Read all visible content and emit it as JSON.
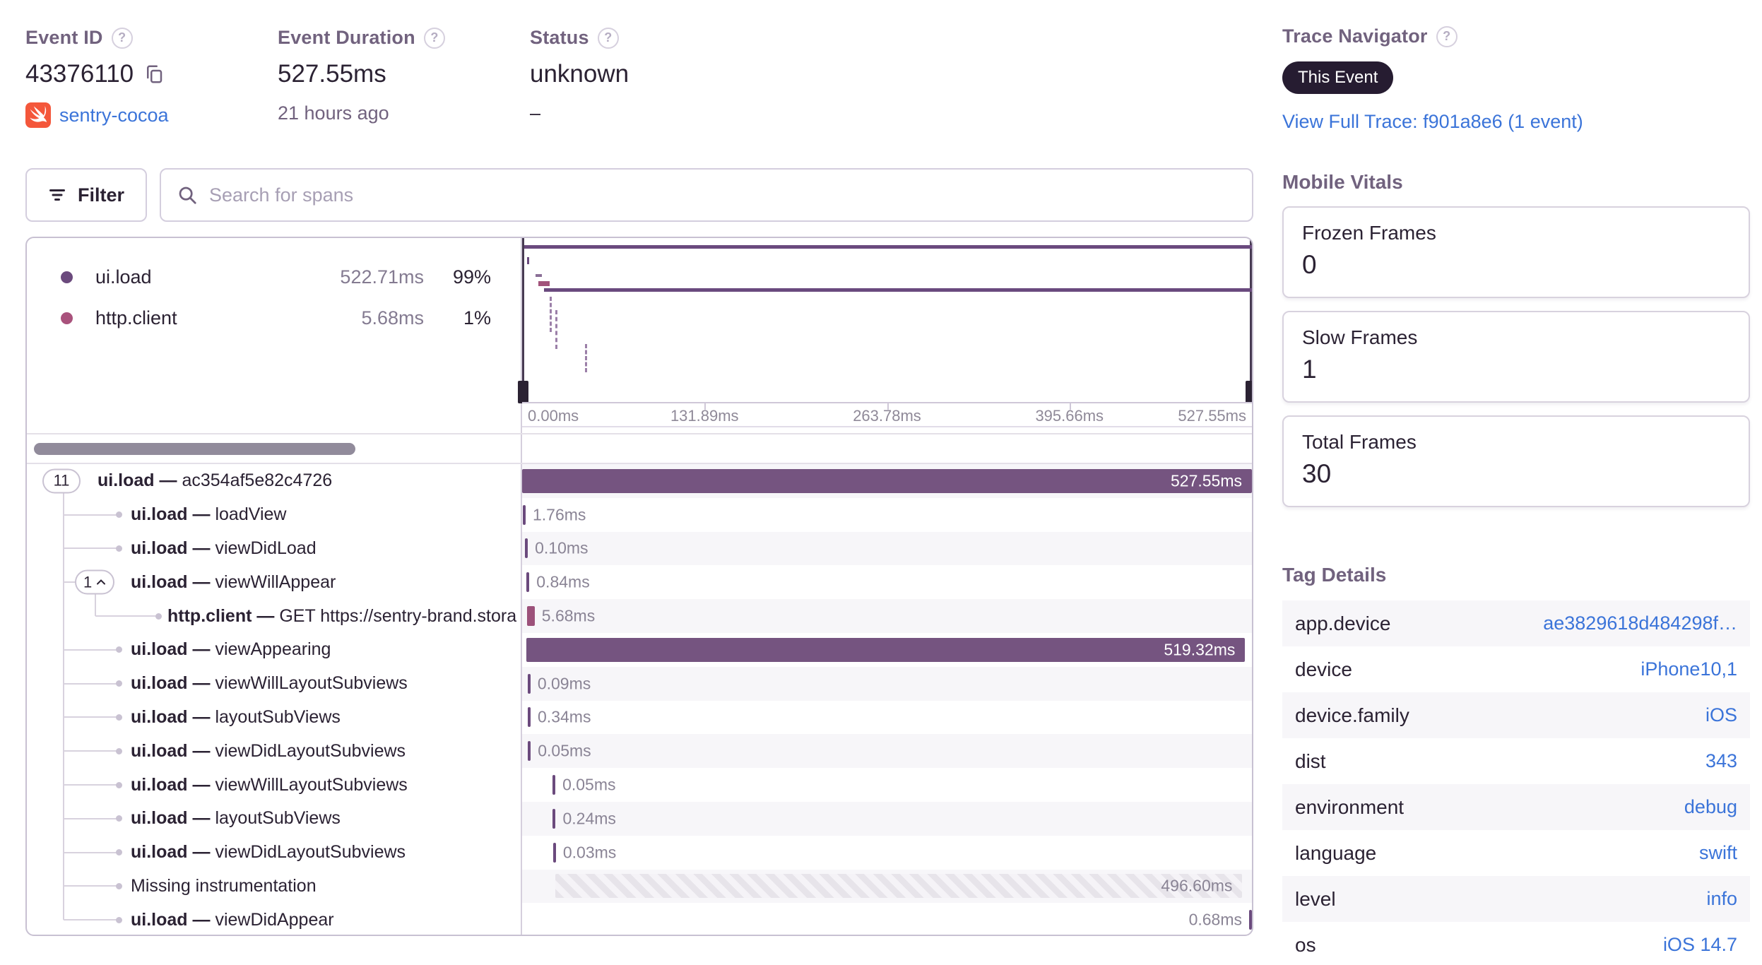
{
  "header": {
    "event_id": {
      "label": "Event ID",
      "value": "43376110",
      "project": "sentry-cocoa"
    },
    "event_duration": {
      "label": "Event Duration",
      "value": "527.55ms",
      "ago": "21 hours ago"
    },
    "status": {
      "label": "Status",
      "value": "unknown",
      "sub": "–"
    },
    "trace_navigator": {
      "label": "Trace Navigator",
      "badge": "This Event",
      "link": "View Full Trace: f901a8e6 (1 event)"
    }
  },
  "toolbar": {
    "filter_label": "Filter",
    "search_placeholder": "Search for spans"
  },
  "legend": [
    {
      "op": "ui.load",
      "duration": "522.71ms",
      "pct": "99%",
      "color": "#6b4a7d"
    },
    {
      "op": "http.client",
      "duration": "5.68ms",
      "pct": "1%",
      "color": "#a9527c"
    }
  ],
  "axis_ticks": [
    "0.00ms",
    "131.89ms",
    "263.78ms",
    "395.66ms",
    "527.55ms"
  ],
  "axis_total_ms": 527.55,
  "spans": [
    {
      "pill": "11",
      "chevron": false,
      "op": "ui.load",
      "name": "ac354af5e82c4726",
      "indent": 0,
      "start": 0,
      "dur": 527.55,
      "display": "527.55ms",
      "kind": "bar",
      "color": "#755480",
      "label_pos": "inside"
    },
    {
      "op": "ui.load",
      "name": "loadView",
      "indent": 1,
      "start": 0.5,
      "dur": 1.76,
      "display": "1.76ms",
      "kind": "tick",
      "color": "#6b4a7d",
      "label_pos": "after"
    },
    {
      "op": "ui.load",
      "name": "viewDidLoad",
      "indent": 1,
      "start": 2.1,
      "dur": 0.1,
      "display": "0.10ms",
      "kind": "tick",
      "color": "#6b4a7d",
      "label_pos": "after"
    },
    {
      "pill": "1",
      "chevron": true,
      "op": "ui.load",
      "name": "viewWillAppear",
      "indent": 1,
      "start": 3.2,
      "dur": 0.84,
      "display": "0.84ms",
      "kind": "tick",
      "color": "#6b4a7d",
      "label_pos": "after"
    },
    {
      "op": "http.client",
      "name": "GET https://sentry-brand.stora",
      "indent": 2,
      "start": 3.4,
      "dur": 5.68,
      "display": "5.68ms",
      "kind": "tick",
      "color": "#9c517a",
      "label_pos": "after"
    },
    {
      "op": "ui.load",
      "name": "viewAppearing",
      "indent": 1,
      "start": 3.3,
      "dur": 519.32,
      "display": "519.32ms",
      "kind": "bar",
      "color": "#755480",
      "label_pos": "inside"
    },
    {
      "op": "ui.load",
      "name": "viewWillLayoutSubviews",
      "indent": 1,
      "start": 4.0,
      "dur": 0.09,
      "display": "0.09ms",
      "kind": "tick",
      "color": "#6b4a7d",
      "label_pos": "after"
    },
    {
      "op": "ui.load",
      "name": "layoutSubViews",
      "indent": 1,
      "start": 4.1,
      "dur": 0.34,
      "display": "0.34ms",
      "kind": "tick",
      "color": "#6b4a7d",
      "label_pos": "after"
    },
    {
      "op": "ui.load",
      "name": "viewDidLayoutSubviews",
      "indent": 1,
      "start": 4.2,
      "dur": 0.05,
      "display": "0.05ms",
      "kind": "tick",
      "color": "#6b4a7d",
      "label_pos": "after"
    },
    {
      "op": "ui.load",
      "name": "viewWillLayoutSubviews",
      "indent": 1,
      "start": 22.0,
      "dur": 0.05,
      "display": "0.05ms",
      "kind": "tick",
      "color": "#6b4a7d",
      "label_pos": "after"
    },
    {
      "op": "ui.load",
      "name": "layoutSubViews",
      "indent": 1,
      "start": 22.2,
      "dur": 0.24,
      "display": "0.24ms",
      "kind": "tick",
      "color": "#6b4a7d",
      "label_pos": "after"
    },
    {
      "op": "ui.load",
      "name": "viewDidLayoutSubviews",
      "indent": 1,
      "start": 22.4,
      "dur": 0.03,
      "display": "0.03ms",
      "kind": "tick",
      "color": "#6b4a7d",
      "label_pos": "after"
    },
    {
      "op": "",
      "name": "Missing instrumentation",
      "indent": 1,
      "start": 24.0,
      "dur": 496.6,
      "display": "496.60ms",
      "kind": "hatch",
      "color": "",
      "label_pos": "inside-gray"
    },
    {
      "op": "ui.load",
      "name": "viewDidAppear",
      "indent": 1,
      "start": 526.5,
      "dur": 0.68,
      "display": "0.68ms",
      "kind": "tick",
      "color": "#6b4a7d",
      "label_pos": "before"
    }
  ],
  "vitals": {
    "title": "Mobile Vitals",
    "cards": [
      {
        "label": "Frozen Frames",
        "value": "0"
      },
      {
        "label": "Slow Frames",
        "value": "1"
      },
      {
        "label": "Total Frames",
        "value": "30"
      }
    ]
  },
  "tags": {
    "title": "Tag Details",
    "rows": [
      {
        "key": "app.device",
        "value": "ae3829618d484298f…"
      },
      {
        "key": "device",
        "value": "iPhone10,1"
      },
      {
        "key": "device.family",
        "value": "iOS"
      },
      {
        "key": "dist",
        "value": "343"
      },
      {
        "key": "environment",
        "value": "debug"
      },
      {
        "key": "language",
        "value": "swift"
      },
      {
        "key": "level",
        "value": "info"
      },
      {
        "key": "os",
        "value": "iOS 14.7"
      }
    ]
  }
}
